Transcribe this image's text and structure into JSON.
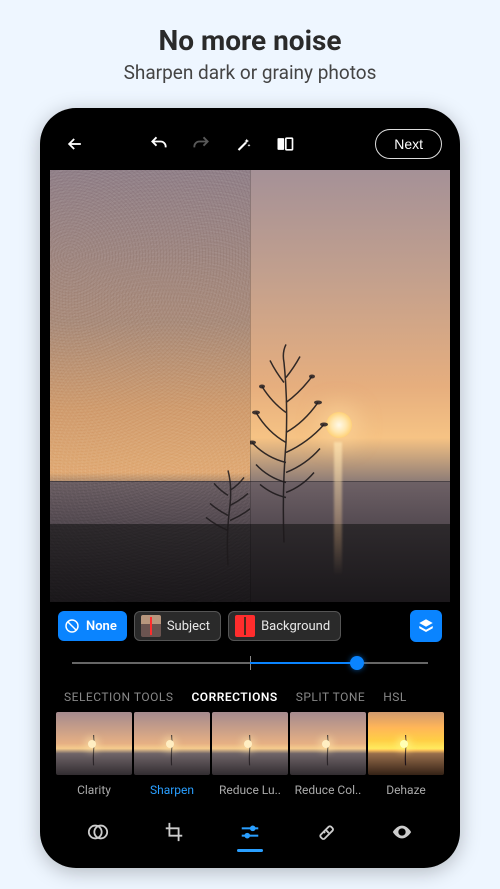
{
  "promo": {
    "title": "No more noise",
    "subtitle": "Sharpen dark or grainy photos"
  },
  "topbar": {
    "next": "Next",
    "icons": {
      "back": "back-arrow-icon",
      "undo": "undo-icon",
      "redo": "redo-icon",
      "auto": "magic-wand-icon",
      "compare": "compare-icon"
    }
  },
  "masks": {
    "none": "None",
    "subject": "Subject",
    "background": "Background"
  },
  "slider": {
    "value_pct": 80,
    "center_pct": 50
  },
  "tabs": {
    "items": [
      "SELECTION TOOLS",
      "CORRECTIONS",
      "SPLIT TONE",
      "HSL"
    ],
    "active_index": 1
  },
  "presets": {
    "items": [
      {
        "label": "Clarity"
      },
      {
        "label": "Sharpen"
      },
      {
        "label": "Reduce Lu.."
      },
      {
        "label": "Reduce Col.."
      },
      {
        "label": "Dehaze"
      }
    ],
    "active_index": 1
  },
  "bottom_nav": {
    "icons": [
      "looks-icon",
      "crop-icon",
      "adjust-sliders-icon",
      "heal-icon",
      "redeye-icon"
    ],
    "active_index": 2
  },
  "colors": {
    "accent": "#0a84ff",
    "accent_light": "#2a9fff"
  }
}
